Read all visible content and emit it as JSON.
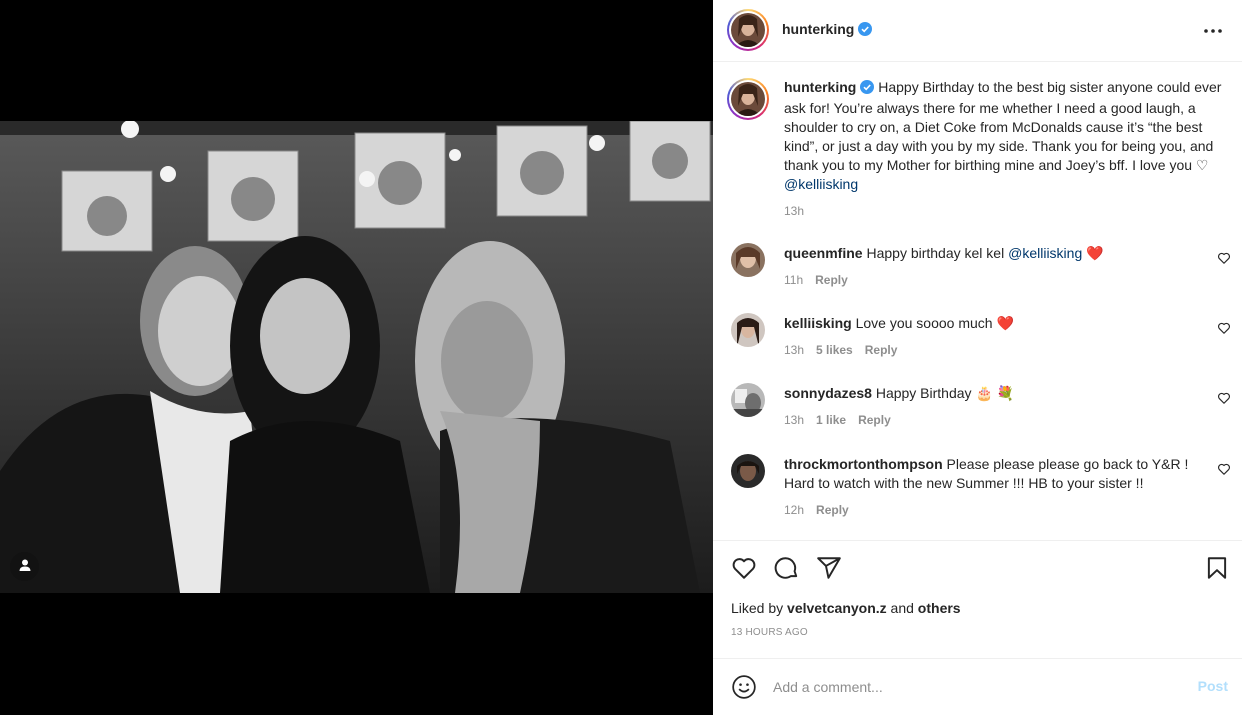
{
  "post": {
    "username": "hunterking",
    "caption_text": "Happy Birthday to the best big sister anyone could ever ask for! You’re always there for me whether I need a good laugh, a shoulder to cry on, a Diet Coke from McDonalds cause it’s “the best kind”, or just a day with you by my side. Thank you for being you, and thank you to my Mother for birthing mine and Joey’s bff. I love you",
    "caption_heart": "♡",
    "caption_mention": "@kelliisking",
    "caption_time": "13h",
    "liked_by_prefix": "Liked by",
    "liked_by_user": "velvetcanyon.z",
    "liked_by_and": "and",
    "liked_by_others": "others",
    "post_time": "13 HOURS AGO"
  },
  "comments": [
    {
      "username": "queenmfine",
      "text": "Happy birthday kel kel",
      "mention": "@kelliisking",
      "emoji": "❤️",
      "time": "11h",
      "likes": "",
      "reply": "Reply"
    },
    {
      "username": "kelliisking",
      "text": "Love you soooo much",
      "mention": "",
      "emoji": "❤️",
      "time": "13h",
      "likes": "5 likes",
      "reply": "Reply"
    },
    {
      "username": "sonnydazes8",
      "text": "Happy Birthday",
      "mention": "",
      "emoji": "🎂 💐",
      "time": "13h",
      "likes": "1 like",
      "reply": "Reply"
    },
    {
      "username": "throckmortonthompson",
      "text": "Please please please go back to Y&R ! Hard to watch with the new Summer !!! HB to your sister !!",
      "mention": "",
      "emoji": "",
      "time": "12h",
      "likes": "",
      "reply": "Reply"
    }
  ],
  "add_comment": {
    "placeholder": "Add a comment...",
    "post_label": "Post"
  },
  "icons": {
    "verified": "verified-badge-icon",
    "more": "more-options-icon",
    "like": "heart-icon",
    "comment": "comment-icon",
    "share": "share-icon",
    "save": "bookmark-icon",
    "emoji": "emoji-icon",
    "tag": "user-tag-icon"
  },
  "colors": {
    "verified": "#3897f0",
    "mention": "#00376b",
    "post_button_disabled": "#b2dffc",
    "heart_red": "#ed4956"
  }
}
